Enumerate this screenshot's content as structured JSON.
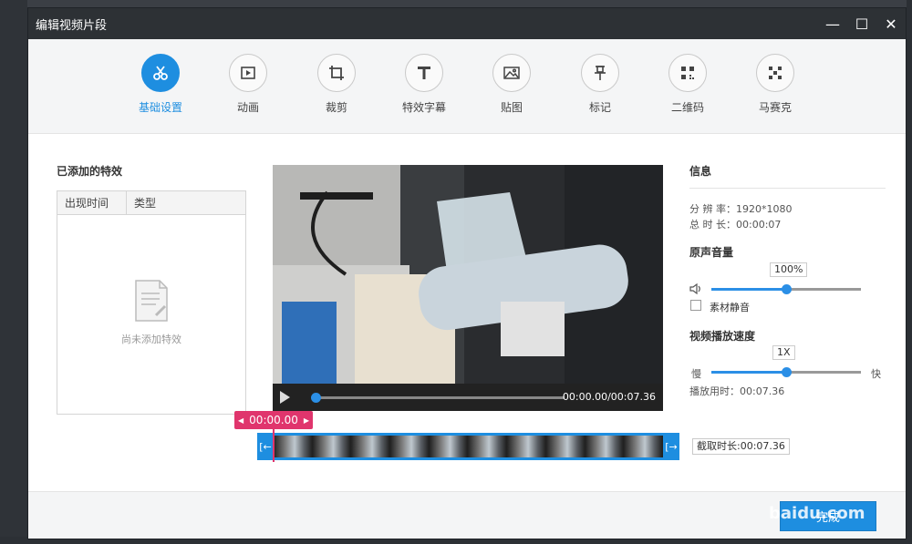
{
  "window": {
    "title": "编辑视频片段",
    "minimize_glyph": "—",
    "maximize_glyph": "☐",
    "close_glyph": "✕"
  },
  "tabs": [
    {
      "label": "基础设置",
      "icon": "scissors-icon",
      "active": true
    },
    {
      "label": "动画",
      "icon": "animation-icon",
      "active": false
    },
    {
      "label": "裁剪",
      "icon": "crop-icon",
      "active": false
    },
    {
      "label": "特效字幕",
      "icon": "text-icon",
      "active": false
    },
    {
      "label": "贴图",
      "icon": "image-icon",
      "active": false
    },
    {
      "label": "标记",
      "icon": "pin-icon",
      "active": false
    },
    {
      "label": "二维码",
      "icon": "qrcode-icon",
      "active": false
    },
    {
      "label": "马赛克",
      "icon": "mosaic-icon",
      "active": false
    }
  ],
  "effects": {
    "title": "已添加的特效",
    "columns": [
      "出现时间",
      "类型"
    ],
    "empty_text": "尚未添加特效"
  },
  "player": {
    "time": "00:00.00/00:07.36",
    "progress": 0
  },
  "timeline": {
    "current_time": "00:00.00",
    "cut_length": "截取时长:00:07.36",
    "left_handle": "[←",
    "right_handle": "[→"
  },
  "info": {
    "title": "信息",
    "resolution_label": "分 辨 率：",
    "resolution_value": "1920*1080",
    "duration_label": "总 时 长：",
    "duration_value": "00:00:07"
  },
  "volume": {
    "title": "原声音量",
    "value_label": "100%",
    "level": 0.5,
    "mute_label": "素材静音",
    "muted": false
  },
  "speed": {
    "title": "视频播放速度",
    "value_label": "1X",
    "level": 0.5,
    "slow_label": "慢",
    "fast_label": "快",
    "play_time_label": "播放用时：",
    "play_time_value": "00:07.36"
  },
  "footer": {
    "finish_label": "完成",
    "watermark": "baidu.com"
  },
  "colors": {
    "accent": "#1e8ee0",
    "marker": "#e0356d",
    "titlebar": "#2d3135"
  }
}
